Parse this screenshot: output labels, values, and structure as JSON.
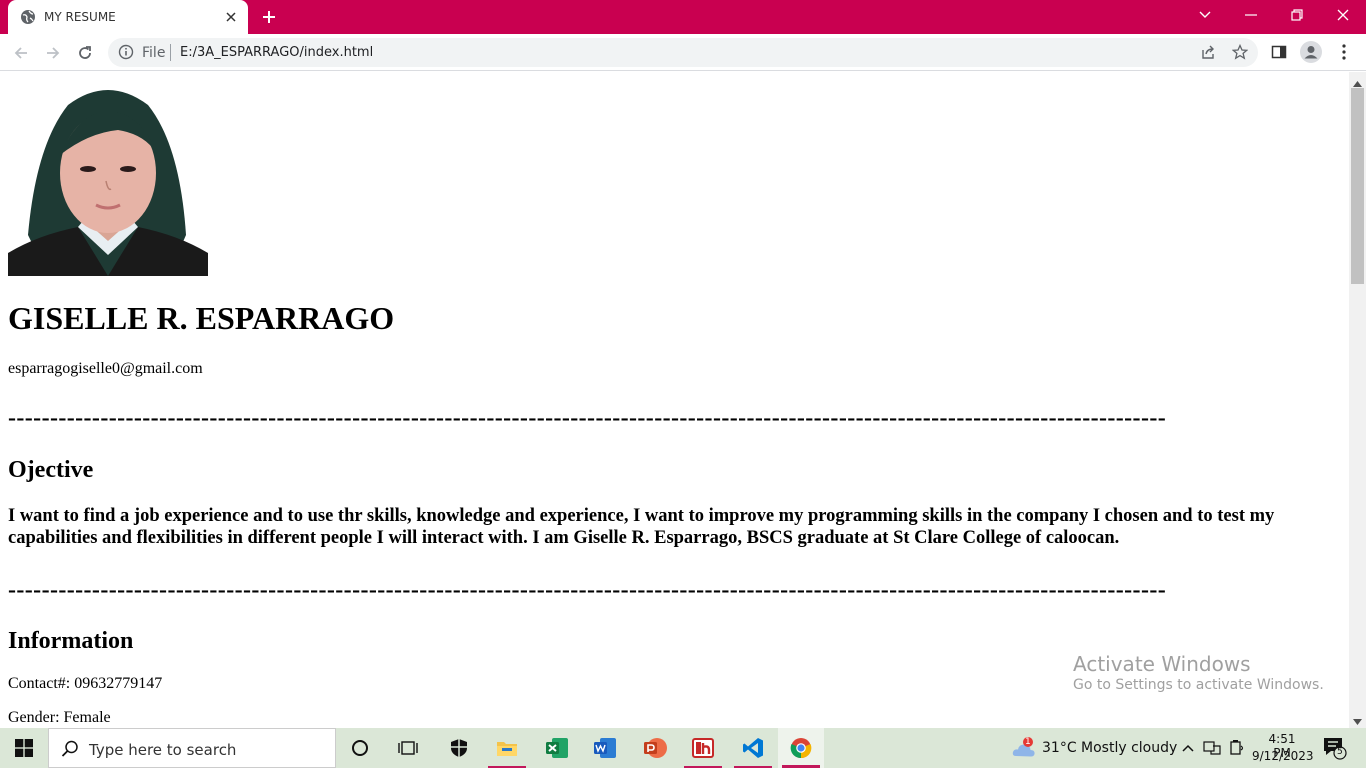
{
  "browser": {
    "tab_title": "MY RESUME",
    "omnibox_scheme": "File",
    "url": "E:/3A_ESPARRAGO/index.html",
    "accent_color": "#c90050"
  },
  "resume": {
    "name": "GISELLE R. ESPARRAGO",
    "email": "esparragogiselle0@gmail.com",
    "divider": "------------------------------------------------------------------------------------------------------------------------------------------",
    "objective_heading": "Ojective",
    "objective_text": "I want to find a job experience and to use thr skills, knowledge and experience, I want to improve my programming skills in the company I chosen and to test my capabilities and flexibilities in different people I will interact with. I am Giselle R. Esparrago, BSCS graduate at St Clare College of caloocan.",
    "information_heading": "Information",
    "contact": "Contact#: 09632779147",
    "gender": "Gender: Female"
  },
  "watermark": {
    "line1": "Activate Windows",
    "line2": "Go to Settings to activate Windows."
  },
  "taskbar": {
    "search_placeholder": "Type here to search",
    "weather": "31°C  Mostly cloudy",
    "weather_badge": "1",
    "time": "4:51 PM",
    "date": "9/12/2023",
    "notification_count": "5"
  }
}
